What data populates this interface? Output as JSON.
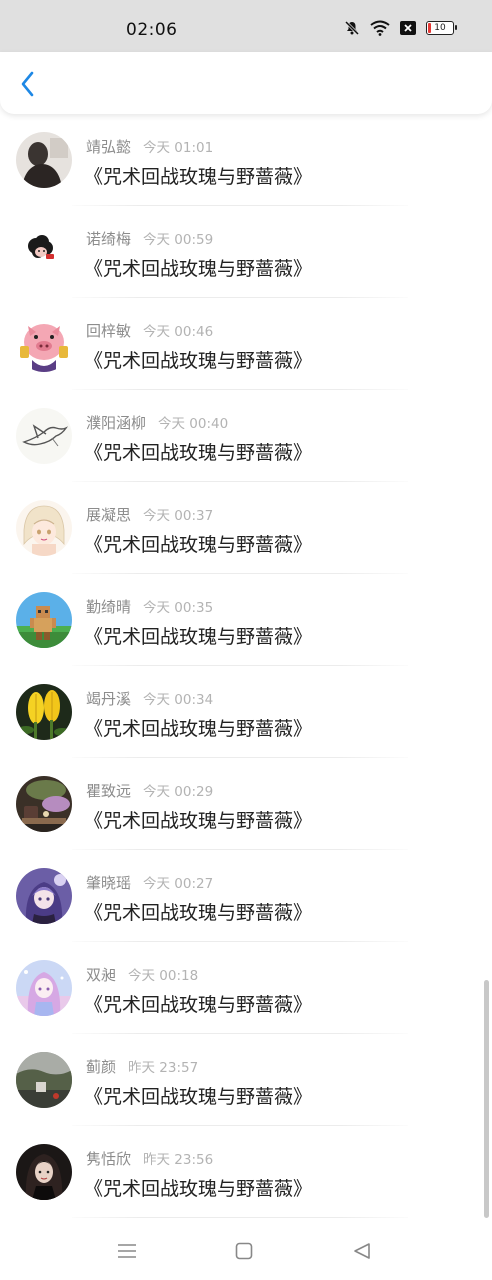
{
  "status_bar": {
    "time": "02:06",
    "battery_level": "10",
    "icons": [
      "mute-bell-icon",
      "wifi-icon",
      "notification-x-icon",
      "battery-icon"
    ]
  },
  "header": {
    "back_icon": "chevron-left-icon"
  },
  "messages": [
    {
      "name": "靖弘懿",
      "time": "今天 01:01",
      "text": "《咒术回战玫瑰与野蔷薇》",
      "avatar": "dark-silhouette"
    },
    {
      "name": "诺绮梅",
      "time": "今天 00:59",
      "text": "《咒术回战玫瑰与野蔷薇》",
      "avatar": "cartoon-sheep"
    },
    {
      "name": "回梓敏",
      "time": "今天 00:46",
      "text": "《咒术回战玫瑰与野蔷薇》",
      "avatar": "pink-pig"
    },
    {
      "name": "濮阳涵柳",
      "time": "今天 00:40",
      "text": "《咒术回战玫瑰与野蔷薇》",
      "avatar": "bird-sketch"
    },
    {
      "name": "展凝思",
      "time": "今天 00:37",
      "text": "《咒术回战玫瑰与野蔷薇》",
      "avatar": "anime-girl-sketch"
    },
    {
      "name": "勤绮晴",
      "time": "今天 00:35",
      "text": "《咒术回战玫瑰与野蔷薇》",
      "avatar": "pixel-character"
    },
    {
      "name": "竭丹溪",
      "time": "今天 00:34",
      "text": "《咒术回战玫瑰与野蔷薇》",
      "avatar": "yellow-flowers"
    },
    {
      "name": "瞿致远",
      "time": "今天 00:29",
      "text": "《咒术回战玫瑰与野蔷薇》",
      "avatar": "still-life"
    },
    {
      "name": "肇晓瑶",
      "time": "今天 00:27",
      "text": "《咒术回战玫瑰与野蔷薇》",
      "avatar": "anime-girl-purple"
    },
    {
      "name": "双昶",
      "time": "今天 00:18",
      "text": "《咒术回战玫瑰与野蔷薇》",
      "avatar": "anime-girl-pastel"
    },
    {
      "name": "蓟颜",
      "time": "昨天 23:57",
      "text": "《咒术回战玫瑰与野蔷薇》",
      "avatar": "landscape"
    },
    {
      "name": "隽恬欣",
      "time": "昨天 23:56",
      "text": "《咒术回战玫瑰与野蔷薇》",
      "avatar": "dark-portrait"
    }
  ],
  "navbar": {
    "icons": [
      "menu-icon",
      "home-square-icon",
      "back-triangle-icon"
    ]
  },
  "colors": {
    "accent": "#1e88e5",
    "name_text": "#8c8c8c",
    "time_text": "#b3b3b3",
    "message_text": "#222222",
    "status_bar_bg": "#e0e0e0"
  }
}
